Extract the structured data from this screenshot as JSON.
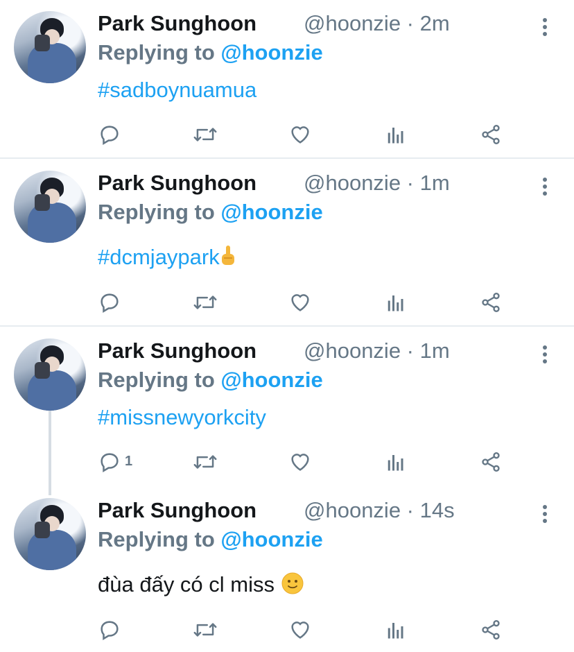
{
  "tweets": [
    {
      "name": "Park Sunghoon",
      "handle": "@hoonzie · 2m",
      "replying_prefix": "Replying to ",
      "replying_mention": "@hoonzie",
      "text": "#sadboynuamua",
      "reply_count": ""
    },
    {
      "name": "Park Sunghoon",
      "handle": "@hoonzie · 1m",
      "replying_prefix": "Replying to ",
      "replying_mention": "@hoonzie",
      "text": "#dcmjaypark",
      "reply_count": ""
    },
    {
      "name": "Park Sunghoon",
      "handle": "@hoonzie · 1m",
      "replying_prefix": "Replying to ",
      "replying_mention": "@hoonzie",
      "text": "#missnewyorkcity",
      "reply_count": "1"
    },
    {
      "name": "Park Sunghoon",
      "handle": "@hoonzie · 14s",
      "replying_prefix": "Replying to ",
      "replying_mention": "@hoonzie",
      "text": "đùa đấy có cl miss",
      "reply_count": ""
    }
  ],
  "icons": {
    "reply": "reply-icon",
    "retweet": "retweet-icon",
    "like": "like-icon",
    "analytics": "analytics-icon",
    "share": "share-icon",
    "more": "more-icon"
  },
  "colors": {
    "link": "#1da1f2",
    "secondary": "#657786",
    "primary_text": "#14171a",
    "divider": "#e6ecf0"
  }
}
